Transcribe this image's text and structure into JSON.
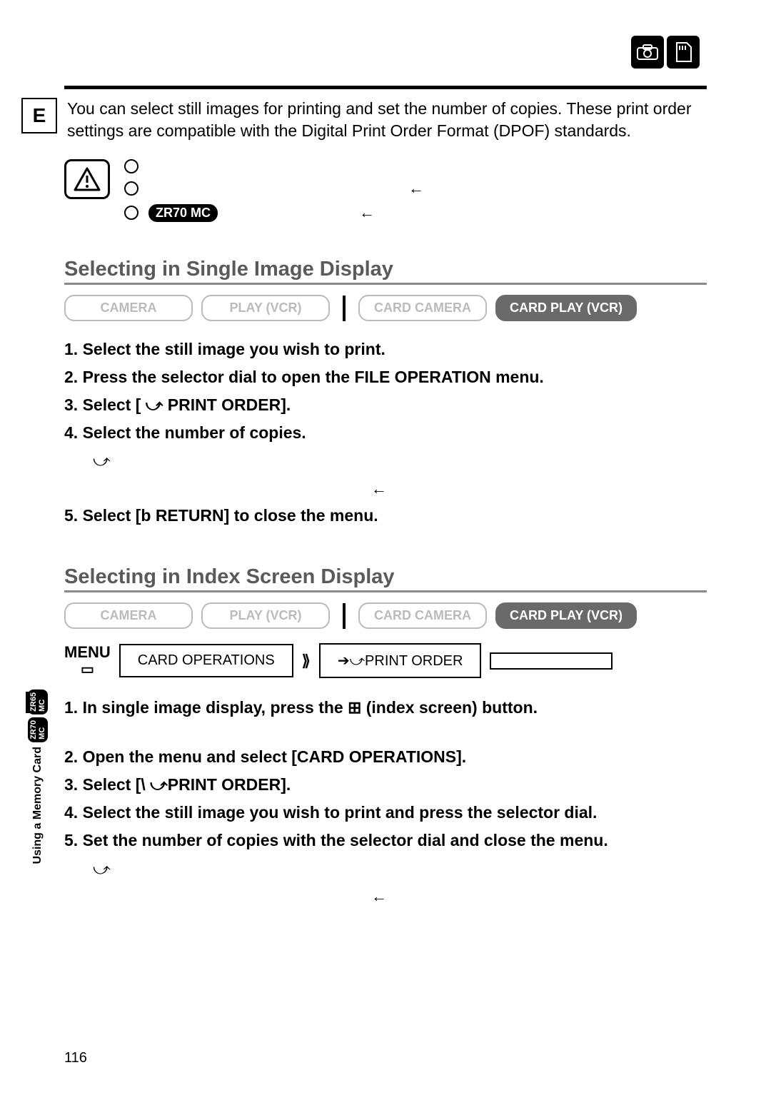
{
  "header_icons": {
    "camera": "camera-icon",
    "card": "card-icon"
  },
  "lang_badge": "E",
  "intro": "You can select still images for printing and set the number of copies. These print order settings are compatible with the Digital Print Order Format (DPOF) standards.",
  "warn_model": "ZR70 MC",
  "sections": {
    "single": {
      "title": "Selecting in Single Image Display",
      "modes": [
        "CAMERA",
        "PLAY (VCR)",
        "CARD CAMERA",
        "CARD PLAY (VCR)"
      ],
      "active_mode_index": 3,
      "steps": [
        "1. Select the still image you wish to print.",
        "2. Press the selector dial to open the FILE OPERATION menu.",
        "3. Select [ ⤻  PRINT ORDER].",
        "4. Select the number of copies.",
        "5. Select [b   RETURN] to close the menu."
      ]
    },
    "index": {
      "title": "Selecting in Index Screen Display",
      "modes": [
        "CAMERA",
        "PLAY (VCR)",
        "CARD CAMERA",
        "CARD PLAY (VCR)"
      ],
      "active_mode_index": 3,
      "menu": {
        "label": "MENU",
        "path1": "CARD OPERATIONS",
        "path2": "➔⤻PRINT ORDER"
      },
      "steps": [
        "1. In single image display, press the  ⊞  (index screen) button.",
        "2. Open the menu and select [CARD OPERATIONS].",
        "3. Select [\\   ⤻PRINT ORDER].",
        "4. Select the still image you wish to print and press the selector dial.",
        "5. Set the number of copies with the selector dial and close the menu."
      ]
    }
  },
  "side": {
    "pills": [
      "ZR70 MC",
      "ZR65 MC"
    ],
    "label": "Using a Memory Card"
  },
  "page_number": "116"
}
